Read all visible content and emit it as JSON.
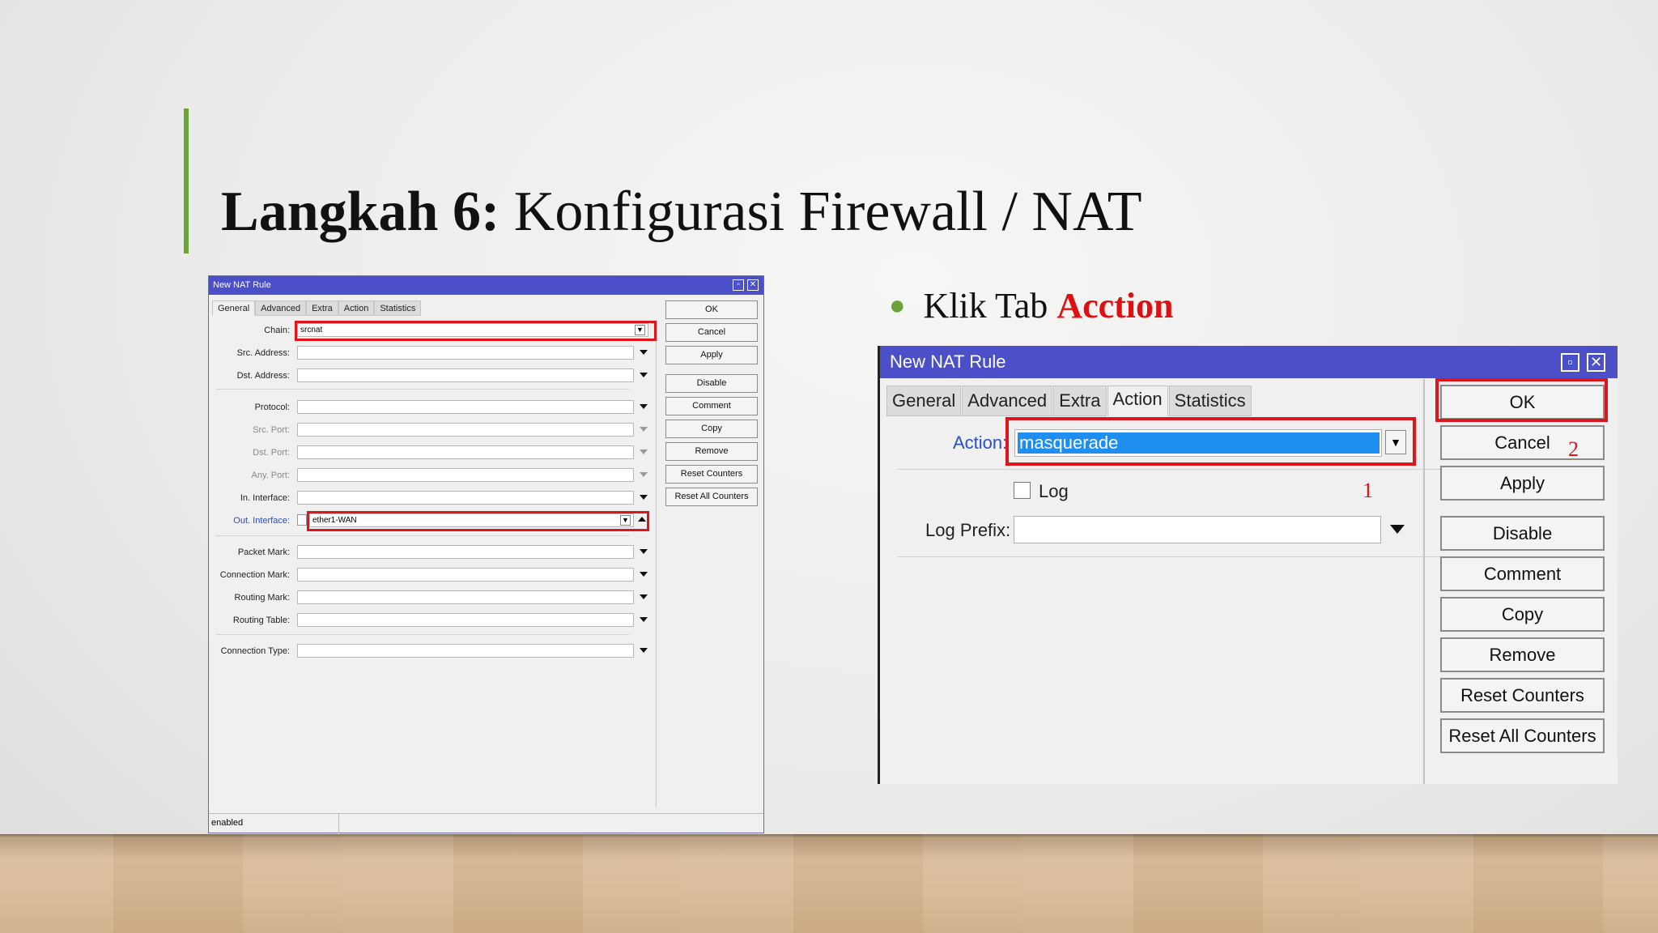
{
  "slide": {
    "title_bold": "Langkah 6:",
    "title_rest": " Konfigurasi Firewall / NAT",
    "bullet_prefix": "Klik Tab ",
    "bullet_highlight": "Acction",
    "accent_color": "#6aa33a",
    "highlight_color": "#e0141b"
  },
  "small_dialog": {
    "title": "New NAT Rule",
    "window_buttons": [
      "▫",
      "✕"
    ],
    "tabs": [
      "General",
      "Advanced",
      "Extra",
      "Action",
      "Statistics"
    ],
    "fields": {
      "chain": {
        "label": "Chain:",
        "value": "srcnat"
      },
      "src_address": {
        "label": "Src. Address:",
        "value": ""
      },
      "dst_address": {
        "label": "Dst. Address:",
        "value": ""
      },
      "protocol": {
        "label": "Protocol:",
        "value": ""
      },
      "src_port": {
        "label": "Src. Port:",
        "value": ""
      },
      "dst_port": {
        "label": "Dst. Port:",
        "value": ""
      },
      "any_port": {
        "label": "Any. Port:",
        "value": ""
      },
      "in_interface": {
        "label": "In. Interface:",
        "value": ""
      },
      "out_interface": {
        "label": "Out. Interface:",
        "value": "ether1-WAN"
      },
      "packet_mark": {
        "label": "Packet Mark:",
        "value": ""
      },
      "connection_mark": {
        "label": "Connection Mark:",
        "value": ""
      },
      "routing_mark": {
        "label": "Routing Mark:",
        "value": ""
      },
      "routing_table": {
        "label": "Routing Table:",
        "value": ""
      },
      "connection_type": {
        "label": "Connection Type:",
        "value": ""
      }
    },
    "buttons": [
      "OK",
      "Cancel",
      "Apply",
      "Disable",
      "Comment",
      "Copy",
      "Remove",
      "Reset Counters",
      "Reset All Counters"
    ],
    "status": "enabled"
  },
  "large_dialog": {
    "title": "New NAT Rule",
    "tabs": [
      "General",
      "Advanced",
      "Extra",
      "Action",
      "Statistics"
    ],
    "action_label": "Action:",
    "action_value": "masquerade",
    "log_label": "Log",
    "log_checked": false,
    "log_prefix_label": "Log Prefix:",
    "log_prefix_value": "",
    "buttons": [
      "OK",
      "Cancel",
      "Apply",
      "Disable",
      "Comment",
      "Copy",
      "Remove",
      "Reset Counters",
      "Reset All Counters"
    ],
    "annotations": {
      "step1": "1",
      "step2": "2"
    }
  }
}
